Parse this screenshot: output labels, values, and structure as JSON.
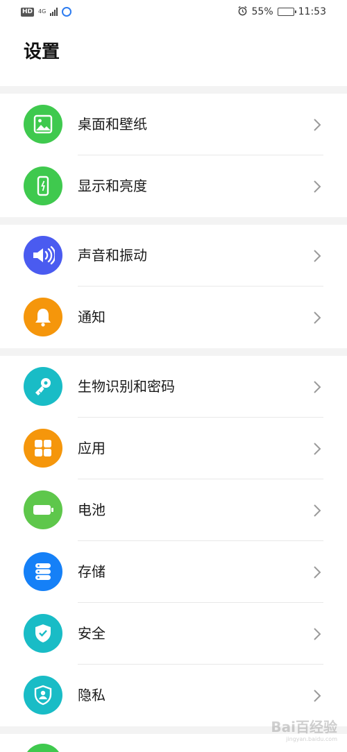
{
  "status_bar": {
    "hd": "HD",
    "network": "4G",
    "alarm_icon": "alarm-icon",
    "battery_percent": "55%",
    "battery_level": 0.55,
    "time": "11:53"
  },
  "page": {
    "title": "设置"
  },
  "colors": {
    "green": "#3fc94e",
    "blue": "#4a5bf0",
    "orange": "#f5960b",
    "teal": "#19bcc6",
    "bright_blue": "#1580f7",
    "battery_green": "#5ec74b"
  },
  "groups": [
    {
      "items": [
        {
          "label": "桌面和壁纸",
          "icon": "wallpaper-icon"
        },
        {
          "label": "显示和亮度",
          "icon": "display-icon"
        }
      ]
    },
    {
      "items": [
        {
          "label": "声音和振动",
          "icon": "sound-icon"
        },
        {
          "label": "通知",
          "icon": "bell-icon"
        }
      ]
    },
    {
      "items": [
        {
          "label": "生物识别和密码",
          "icon": "key-icon"
        },
        {
          "label": "应用",
          "icon": "apps-grid-icon"
        },
        {
          "label": "电池",
          "icon": "battery-icon"
        },
        {
          "label": "存储",
          "icon": "storage-icon"
        },
        {
          "label": "安全",
          "icon": "shield-check-icon"
        },
        {
          "label": "隐私",
          "icon": "privacy-shield-icon"
        }
      ]
    }
  ],
  "watermark": {
    "text": "Bai百经验",
    "sub": "jingyan.baidu.com"
  }
}
